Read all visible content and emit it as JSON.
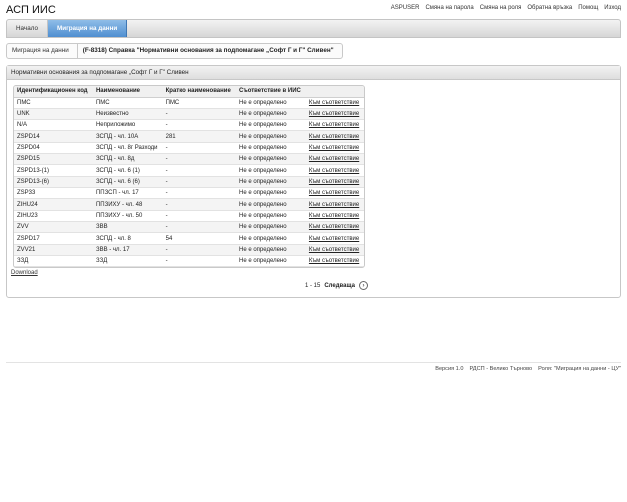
{
  "app": {
    "title": "АСП ИИС"
  },
  "top_links": [
    "ASPUSER",
    "Смяна на парола",
    "Смяна на роля",
    "Обратна връзка",
    "Помощ",
    "Изход"
  ],
  "nav": {
    "tabs": [
      {
        "label": "Начало",
        "active": false
      },
      {
        "label": "Миграция на данни",
        "active": true
      }
    ]
  },
  "breadcrumb": {
    "items": [
      "Миграция на данни",
      "(F-8318) Справка \"Нормативни основания за подпомагане „Софт Г и Г\" Сливен\""
    ]
  },
  "panel": {
    "title": "Нормативни основания за подпомагане „Софт Г и Г\" Сливен",
    "table": {
      "columns": [
        "Идентификационен код",
        "Наименование",
        "Кратко наименование",
        "Съответствие в ИИС",
        ""
      ],
      "rows": [
        [
          "ПМС",
          "ПМС",
          "ПМС",
          "Не е определено",
          "Към съответствие"
        ],
        [
          "UNK",
          "Неизвестно",
          "-",
          "Не е определено",
          "Към съответствие"
        ],
        [
          "N/A",
          "Неприложимо",
          "-",
          "Не е определено",
          "Към съответствие"
        ],
        [
          "ZSPD14",
          "ЗСПД - чл. 10А",
          "281",
          "Не е определено",
          "Към съответствие"
        ],
        [
          "ZSPD04",
          "ЗСПД - чл. 8г Разходи",
          "-",
          "Не е определено",
          "Към съответствие"
        ],
        [
          "ZSPD15",
          "ЗСПД - чл. 8д",
          "-",
          "Не е определено",
          "Към съответствие"
        ],
        [
          "ZSPD13-(1)",
          "ЗСПД - чл. 6 (1)",
          "-",
          "Не е определено",
          "Към съответствие"
        ],
        [
          "ZSPD13-(6)",
          "ЗСПД - чл. 6 (6)",
          "-",
          "Не е определено",
          "Към съответствие"
        ],
        [
          "ZSP33",
          "ППЗСП - чл. 17",
          "-",
          "Не е определено",
          "Към съответствие"
        ],
        [
          "ZIHU24",
          "ППЗИХУ - чл. 48",
          "-",
          "Не е определено",
          "Към съответствие"
        ],
        [
          "ZIHU23",
          "ППЗИХУ - чл. 50",
          "-",
          "Не е определено",
          "Към съответствие"
        ],
        [
          "ZVV",
          "ЗВВ",
          "-",
          "Не е определено",
          "Към съответствие"
        ],
        [
          "ZSPD17",
          "ЗСПД - чл. 8",
          "54",
          "Не е определено",
          "Към съответствие"
        ],
        [
          "ZVV21",
          "ЗВВ - чл. 17",
          "-",
          "Не е определено",
          "Към съответствие"
        ],
        [
          "ЗЗД",
          "ЗЗД",
          "-",
          "Не е определено",
          "Към съответствие"
        ]
      ]
    },
    "download_label": "Download",
    "pager": {
      "range": "1 - 15",
      "next_label": "Следваща",
      "next_icon": "chevron-right-icon"
    }
  },
  "footer": {
    "items": [
      "Версия 1.0",
      "РДСП - Велико Търново",
      "Роля: \"Миграция на данни - ЦУ\""
    ]
  }
}
